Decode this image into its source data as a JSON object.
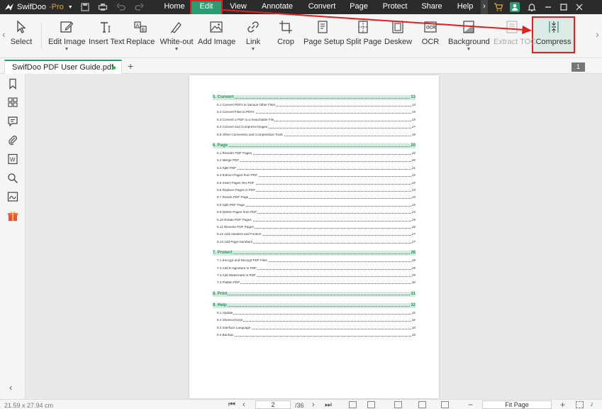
{
  "title_bar": {
    "brand": "SwifDoo",
    "brand_suffix": "·Pro",
    "menus": [
      "Home",
      "Edit",
      "View",
      "Annotate",
      "Convert",
      "Page",
      "Protect",
      "Share",
      "Help"
    ],
    "active_menu": "Edit"
  },
  "ribbon": {
    "tools": [
      {
        "label": "Select",
        "icon": "cursor-icon"
      },
      {
        "label": "Edit Image",
        "icon": "edit-image-icon",
        "dropdown": true
      },
      {
        "label": "Insert Text",
        "icon": "insert-text-icon"
      },
      {
        "label": "Replace",
        "icon": "replace-icon"
      },
      {
        "label": "White-out",
        "icon": "white-out-icon",
        "dropdown": true
      },
      {
        "label": "Add Image",
        "icon": "add-image-icon"
      },
      {
        "label": "Link",
        "icon": "link-icon",
        "dropdown": true
      },
      {
        "label": "Crop",
        "icon": "crop-icon"
      },
      {
        "label": "Page Setup",
        "icon": "page-setup-icon"
      },
      {
        "label": "Split Page",
        "icon": "split-page-icon"
      },
      {
        "label": "Deskew",
        "icon": "deskew-icon"
      },
      {
        "label": "OCR",
        "icon": "ocr-icon"
      },
      {
        "label": "Background",
        "icon": "background-icon",
        "dropdown": true
      },
      {
        "label": "Extract TOC",
        "icon": "extract-toc-icon",
        "disabled": true
      },
      {
        "label": "Compress",
        "icon": "compress-icon",
        "highlighted": true
      }
    ]
  },
  "tabs": {
    "document": "SwifDoo PDF User Guide.pdf",
    "page_badge": "1"
  },
  "toc": [
    {
      "kind": "section",
      "title": "5. Convert",
      "page": "13"
    },
    {
      "kind": "item",
      "title": "5.1 Convert PDFs to Various Other Files",
      "page": "13"
    },
    {
      "kind": "item",
      "title": "5.2 Convert Files to PDFs",
      "page": "15"
    },
    {
      "kind": "item",
      "title": "5.3 Convert a PDF to a Searchable File",
      "page": "15"
    },
    {
      "kind": "item",
      "title": "5.4 Convert and Compress Images",
      "page": "17"
    },
    {
      "kind": "item",
      "title": "5.5 Other Conversion and Compression Tools",
      "page": "19"
    },
    {
      "kind": "section",
      "title": "6. Page",
      "page": "20"
    },
    {
      "kind": "item",
      "title": "6.1 Reorder PDF Pages",
      "page": "20"
    },
    {
      "kind": "item",
      "title": "6.2 Merge PDF",
      "page": "20"
    },
    {
      "kind": "item",
      "title": "6.3 Split PDF",
      "page": "21"
    },
    {
      "kind": "item",
      "title": "6.4 Extract Pages from PDF",
      "page": "22"
    },
    {
      "kind": "item",
      "title": "6.5 Insert Pages into PDF",
      "page": "22"
    },
    {
      "kind": "item",
      "title": "6.6 Replace Pages in PDF",
      "page": "23"
    },
    {
      "kind": "item",
      "title": "6.7 Resize PDF Page",
      "page": "23"
    },
    {
      "kind": "item",
      "title": "6.8 Split PDF Page",
      "page": "24"
    },
    {
      "kind": "item",
      "title": "6.9 Delete Pages from PDF",
      "page": "24"
    },
    {
      "kind": "item",
      "title": "6.10 Rotate PDF Pages",
      "page": "25"
    },
    {
      "kind": "item",
      "title": "6.11 Reverse PDF Pages",
      "page": "26"
    },
    {
      "kind": "item",
      "title": "6.12 Add Headers and Footers",
      "page": "27"
    },
    {
      "kind": "item",
      "title": "6.13 Add Page Numbers",
      "page": "27"
    },
    {
      "kind": "section",
      "title": "7. Protect",
      "page": "28"
    },
    {
      "kind": "item",
      "title": "7.1 Encrypt and Decrypt PDF Files",
      "page": "28"
    },
    {
      "kind": "item",
      "title": "7.2 Add E-signature to PDF",
      "page": "29"
    },
    {
      "kind": "item",
      "title": "7.3 Add Watermark to PDF",
      "page": "29"
    },
    {
      "kind": "item",
      "title": "7.4 Flatten PDF",
      "page": "30"
    },
    {
      "kind": "section",
      "title": "8. Print",
      "page": "31"
    },
    {
      "kind": "section",
      "title": "9. Help",
      "page": "32"
    },
    {
      "kind": "item",
      "title": "9.1 Update",
      "page": "32"
    },
    {
      "kind": "item",
      "title": "9.2 Shortcut Keys",
      "page": "32"
    },
    {
      "kind": "item",
      "title": "9.3 Interface Language",
      "page": "33"
    },
    {
      "kind": "item",
      "title": "9.4 Backup",
      "page": "33"
    }
  ],
  "status_bar": {
    "page_size": "21.59 x 27.94 cm",
    "current_page": "2",
    "total_pages": "/36",
    "zoom": "Fit Page"
  },
  "colors": {
    "title_bar": "#2b2b2b",
    "accent": "#2b9b71",
    "highlight_red": "#e02020",
    "toc_green": "#1f9b58"
  }
}
